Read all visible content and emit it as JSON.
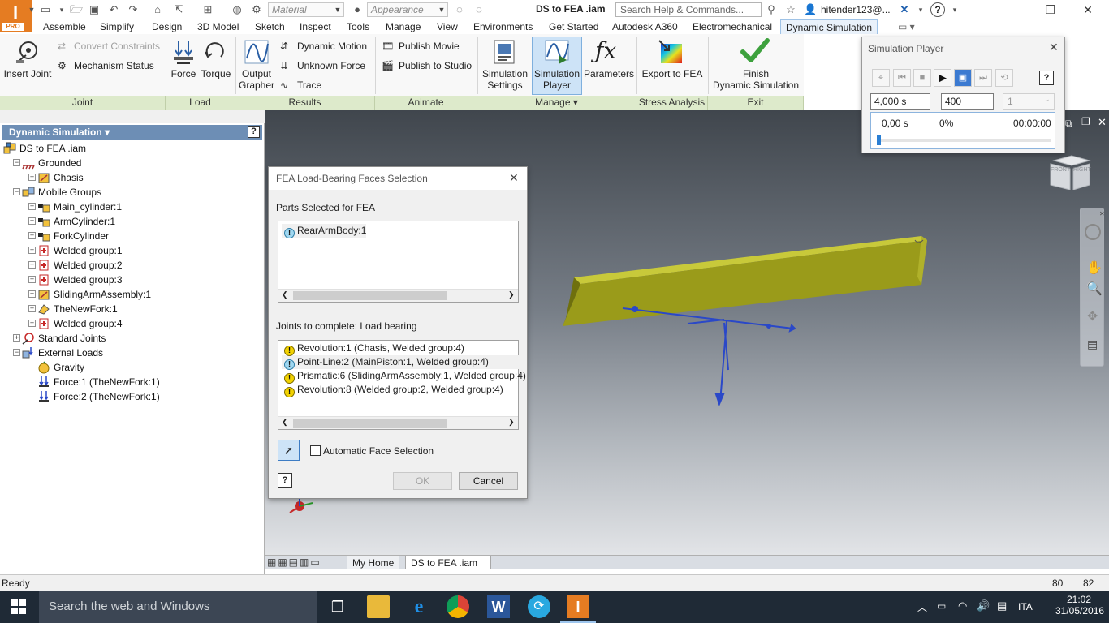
{
  "app": {
    "doc_title": "DS to FEA .iam",
    "pro_badge": "PRO",
    "material": "Material",
    "appearance": "Appearance",
    "search_placeholder": "Search Help & Commands...",
    "user": "hitender123@...",
    "help": "?"
  },
  "tabs": [
    "Assemble",
    "Simplify",
    "Design",
    "3D Model",
    "Sketch",
    "Inspect",
    "Tools",
    "Manage",
    "View",
    "Environments",
    "Get Started",
    "Autodesk A360",
    "Electromechanical",
    "Dynamic Simulation"
  ],
  "ribbon": {
    "insert_joint": "Insert Joint",
    "convert_constraints": "Convert Constraints",
    "mechanism_status": "Mechanism Status",
    "force": "Force",
    "torque": "Torque",
    "output_grapher_1": "Output",
    "output_grapher_2": "Grapher",
    "dynamic_motion": "Dynamic Motion",
    "unknown_force": "Unknown Force",
    "trace": "Trace",
    "publish_movie": "Publish Movie",
    "publish_studio": "Publish to Studio",
    "sim_settings_1": "Simulation",
    "sim_settings_2": "Settings",
    "sim_player_1": "Simulation",
    "sim_player_2": "Player",
    "parameters": "Parameters",
    "export_fea": "Export to FEA",
    "finish_1": "Finish",
    "finish_2": "Dynamic Simulation",
    "panels": {
      "joint": "Joint",
      "load": "Load",
      "results": "Results",
      "animate": "Animate",
      "manage": "Manage ▾",
      "stress": "Stress Analysis",
      "exit": "Exit"
    }
  },
  "browser": {
    "title": "Dynamic Simulation ▾",
    "help": "?",
    "items": [
      {
        "label": "DS to FEA .iam",
        "level": 0,
        "icon": "assembly",
        "exp": ""
      },
      {
        "label": "Grounded",
        "level": 1,
        "icon": "grounded",
        "exp": "−"
      },
      {
        "label": "Chasis",
        "level": 2,
        "icon": "part",
        "exp": "+"
      },
      {
        "label": "Mobile Groups",
        "level": 1,
        "icon": "groups",
        "exp": "−"
      },
      {
        "label": "Main_cylinder:1",
        "level": 2,
        "icon": "subasm",
        "exp": "+"
      },
      {
        "label": "ArmCylinder:1",
        "level": 2,
        "icon": "subasm",
        "exp": "+"
      },
      {
        "label": "ForkCylinder",
        "level": 2,
        "icon": "subasm",
        "exp": "+"
      },
      {
        "label": "Welded group:1",
        "level": 2,
        "icon": "welded",
        "exp": "+"
      },
      {
        "label": "Welded group:2",
        "level": 2,
        "icon": "welded",
        "exp": "+"
      },
      {
        "label": "Welded group:3",
        "level": 2,
        "icon": "welded",
        "exp": "+"
      },
      {
        "label": "SlidingArmAssembly:1",
        "level": 2,
        "icon": "part",
        "exp": "+"
      },
      {
        "label": "TheNewFork:1",
        "level": 2,
        "icon": "fork",
        "exp": "+"
      },
      {
        "label": "Welded group:4",
        "level": 2,
        "icon": "welded",
        "exp": "+"
      },
      {
        "label": "Standard Joints",
        "level": 1,
        "icon": "joints",
        "exp": "+"
      },
      {
        "label": "External Loads",
        "level": 1,
        "icon": "loads",
        "exp": "−"
      },
      {
        "label": "Gravity",
        "level": 2,
        "icon": "gravity",
        "exp": ""
      },
      {
        "label": "Force:1 (TheNewFork:1)",
        "level": 2,
        "icon": "force",
        "exp": ""
      },
      {
        "label": "Force:2 (TheNewFork:1)",
        "level": 2,
        "icon": "force",
        "exp": ""
      }
    ]
  },
  "dialog": {
    "title": "FEA Load-Bearing Faces Selection",
    "parts_label": "Parts Selected for FEA",
    "parts": [
      {
        "label": "RearArmBody:1",
        "type": "info"
      }
    ],
    "joints_label": "Joints to complete: Load bearing",
    "joints": [
      {
        "label": "Revolution:1 (Chasis, Welded group:4)",
        "type": "warn"
      },
      {
        "label": "Point-Line:2 (MainPiston:1, Welded group:4)",
        "type": "info"
      },
      {
        "label": "Prismatic:6 (SlidingArmAssembly:1, Welded group:4)",
        "type": "warn"
      },
      {
        "label": "Revolution:8 (Welded group:2, Welded group:4)",
        "type": "warn"
      }
    ],
    "auto_face": "Automatic Face Selection",
    "ok": "OK",
    "cancel": "Cancel",
    "help": "?"
  },
  "simplayer": {
    "title": "Simulation Player",
    "end_time": "4,000 s",
    "images": "400",
    "filter": "1",
    "time": "0,00 s",
    "percent": "0%",
    "elapsed": "00:00:00",
    "progress": 0.0,
    "help": "?"
  },
  "viewcube": {
    "front": "FRONT",
    "right": "RIGHT"
  },
  "doctabs": {
    "home": "My Home",
    "doc": "DS to FEA .iam",
    "close": "⊠"
  },
  "status": {
    "left": "Ready",
    "n1": "80",
    "n2": "82"
  },
  "taskbar": {
    "search": "Search the web and Windows",
    "lang": "ITA",
    "time": "21:02",
    "date": "31/05/2016"
  }
}
